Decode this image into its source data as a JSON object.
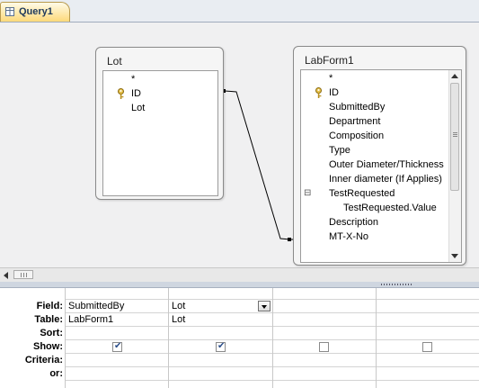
{
  "tab": {
    "title": "Query1",
    "icon": "query-icon"
  },
  "tables": [
    {
      "name": "Lot",
      "fields": [
        "*",
        "ID",
        "Lot"
      ],
      "key_field": "ID"
    },
    {
      "name": "LabForm1",
      "fields": [
        "*",
        "ID",
        "SubmittedBy",
        "Department",
        "Composition",
        "Type",
        "Outer Diameter/Thickness",
        "Inner diameter (If Applies)",
        "TestRequested",
        "TestRequested.Value",
        "Description",
        "MT-X-No"
      ],
      "key_field": "ID",
      "expanded_field": "TestRequested",
      "expand_symbol": "⊟"
    }
  ],
  "grid": {
    "row_labels": [
      "Field:",
      "Table:",
      "Sort:",
      "Show:",
      "Criteria:",
      "or:"
    ],
    "columns": [
      {
        "field": "SubmittedBy",
        "table": "LabForm1",
        "sort": "",
        "show": true
      },
      {
        "field": "Lot",
        "table": "Lot",
        "sort": "",
        "show": true,
        "has_dropdown": true
      },
      {
        "field": "",
        "table": "",
        "sort": "",
        "show": false
      },
      {
        "field": "",
        "table": "",
        "sort": "",
        "show": false
      }
    ]
  },
  "colors": {
    "tab_gold": "#fdd97a",
    "design_bg": "#f0f0f1",
    "check_mark": "#2a4d8a"
  }
}
